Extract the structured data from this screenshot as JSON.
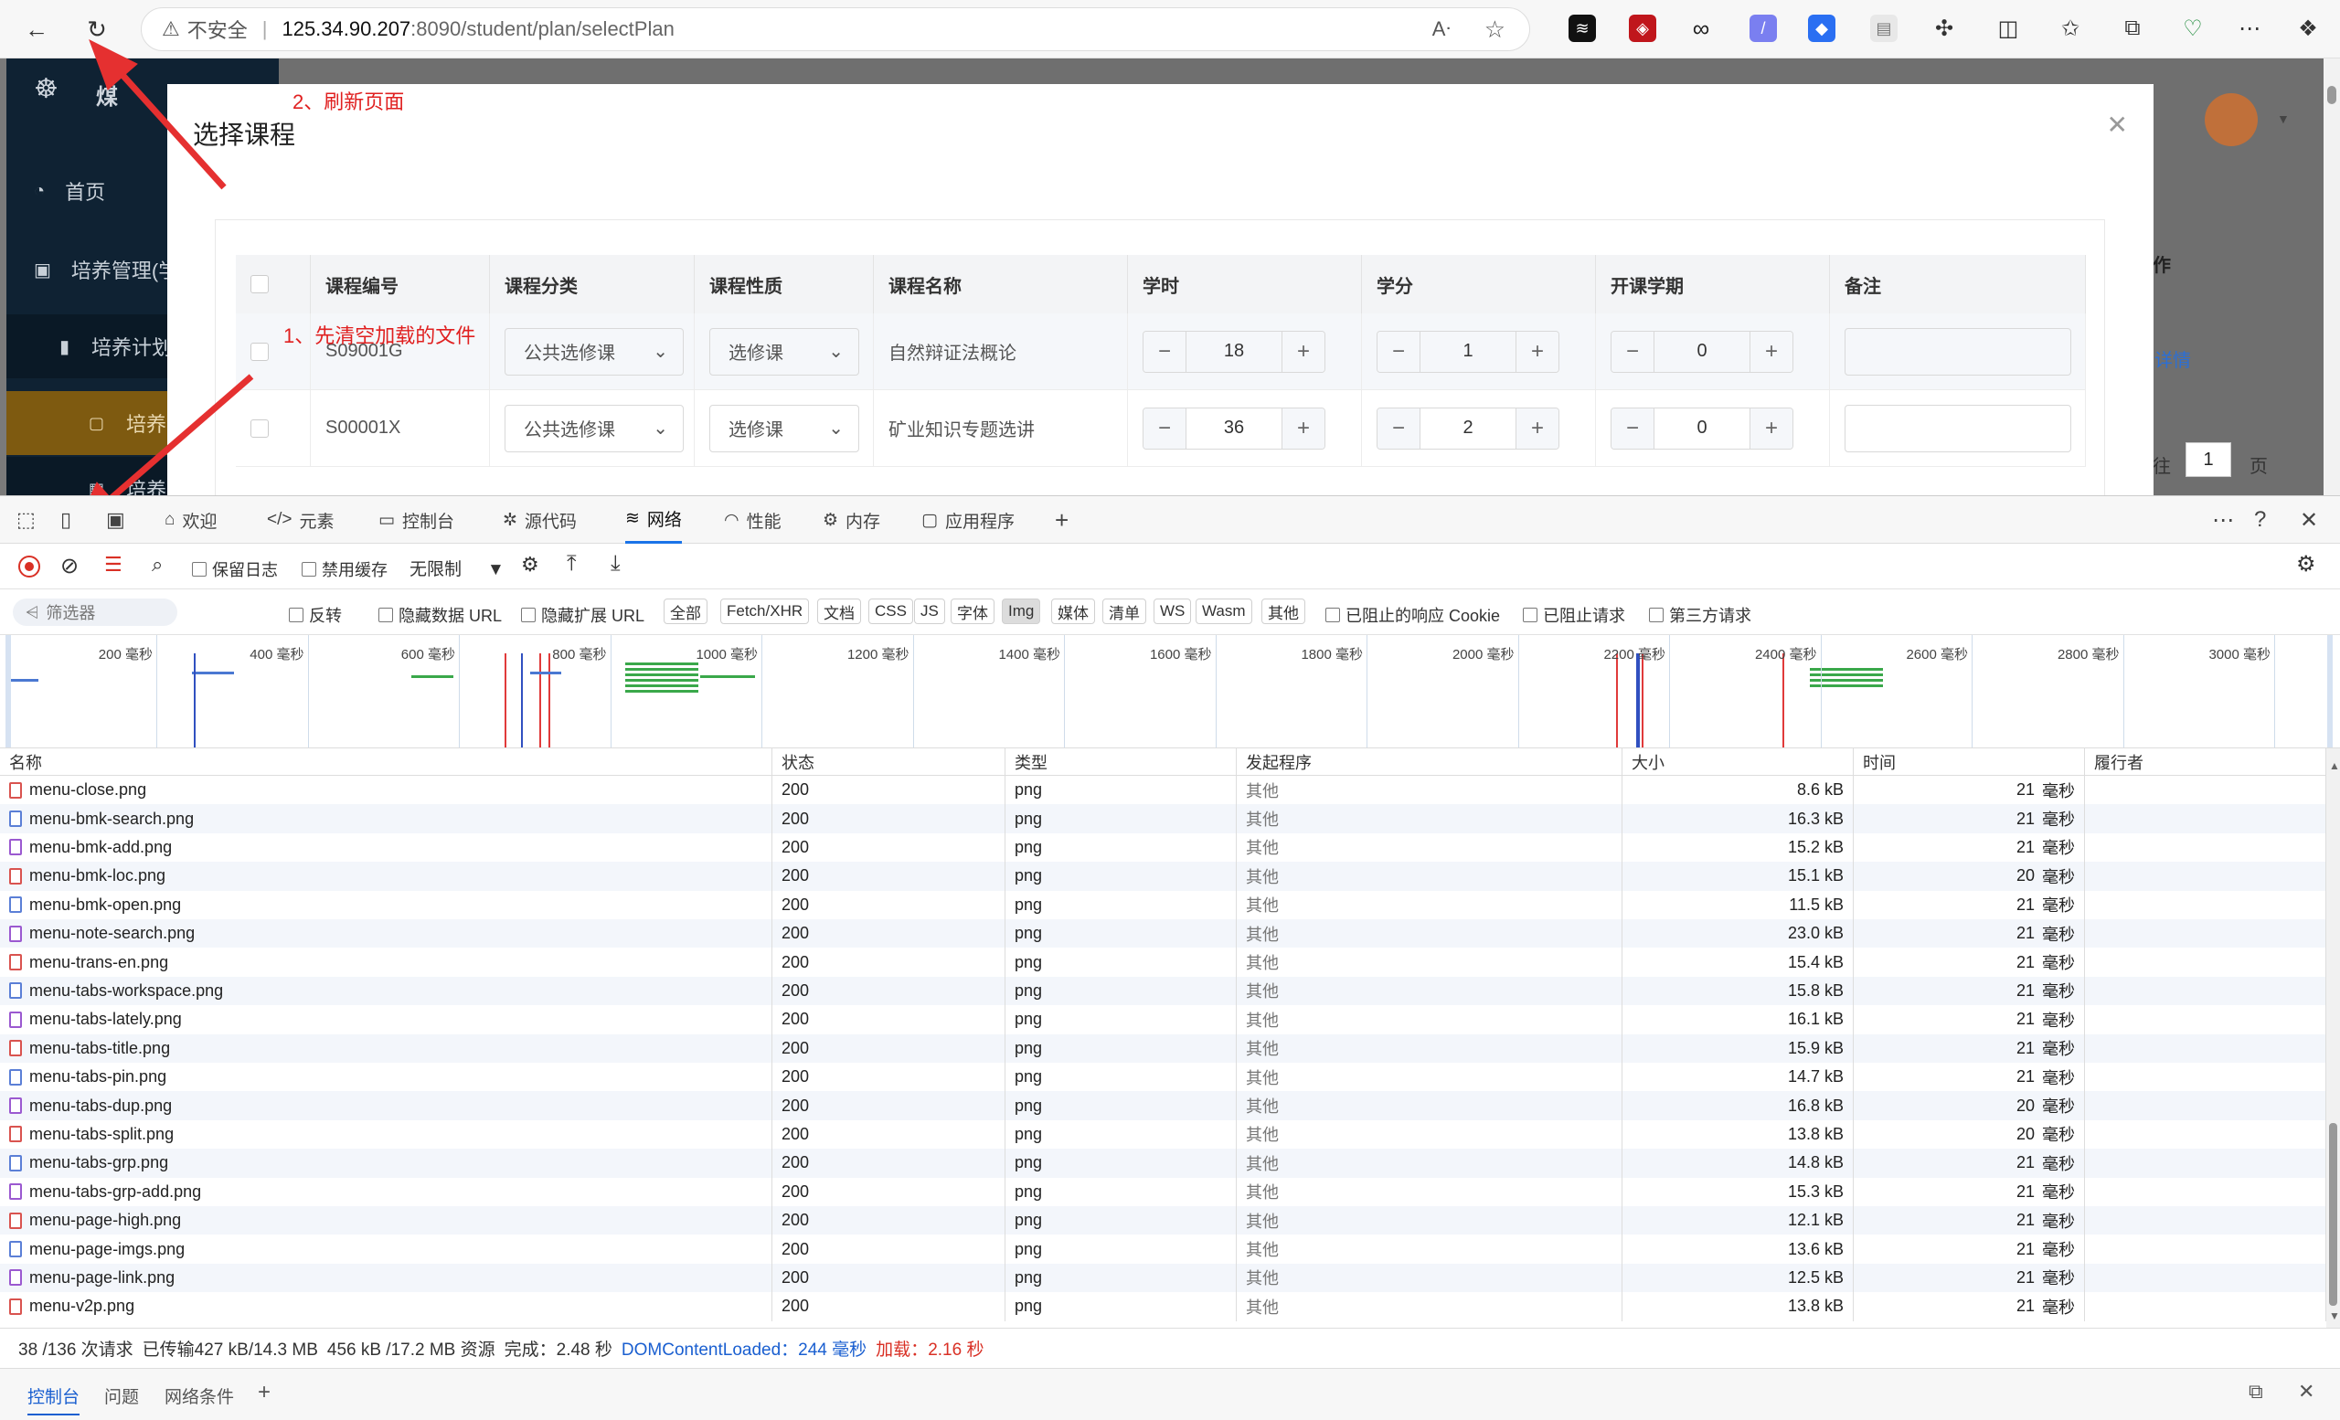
{
  "browser": {
    "insecure_label": "不安全",
    "url_host": "125.34.90.207",
    "url_path": ":8090/student/plan/selectPlan"
  },
  "sidebar": {
    "brand": "煤",
    "items": [
      {
        "label": "首页"
      },
      {
        "label": "培养管理(学"
      },
      {
        "label": "培养计划"
      },
      {
        "label": "培养"
      },
      {
        "label": "培养"
      }
    ]
  },
  "main_bg": {
    "op_header": "作",
    "detail_link": "详情",
    "page_number": "1",
    "page_suffix": "页",
    "page_prefix": "往"
  },
  "modal": {
    "title": "选择课程",
    "columns": [
      "课程编号",
      "课程分类",
      "课程性质",
      "课程名称",
      "学时",
      "学分",
      "开课学期",
      "备注"
    ],
    "rows": [
      {
        "code": "S09001G",
        "category": "公共选修课",
        "nature": "选修课",
        "name": "自然辩证法概论",
        "hours": "18",
        "credits": "1",
        "term": "0"
      },
      {
        "code": "S00001X",
        "category": "公共选修课",
        "nature": "选修课",
        "name": "矿业知识专题选讲",
        "hours": "36",
        "credits": "2",
        "term": "0"
      }
    ]
  },
  "annotations": {
    "step1": "1、先清空加载的文件",
    "step2": "2、刷新页面"
  },
  "devtools": {
    "tabs": [
      "欢迎",
      "元素",
      "控制台",
      "源代码",
      "网络",
      "性能",
      "内存",
      "应用程序"
    ],
    "active_tab": "网络",
    "toolbar": {
      "preserve_log": "保留日志",
      "disable_cache": "禁用缓存",
      "throttle": "无限制"
    },
    "filter": {
      "placeholder": "筛选器",
      "invert": "反转",
      "hide_data_urls": "隐藏数据 URL",
      "hide_ext_urls": "隐藏扩展 URL",
      "types": [
        "全部",
        "Fetch/XHR",
        "文档",
        "CSS",
        "JS",
        "字体",
        "Img",
        "媒体",
        "清单",
        "WS",
        "Wasm",
        "其他"
      ],
      "active_type": "Img",
      "blocked_cookies": "已阻止的响应 Cookie",
      "blocked_requests": "已阻止请求",
      "third_party": "第三方请求"
    },
    "timeline_ticks": [
      "200 毫秒",
      "400 毫秒",
      "600 毫秒",
      "800 毫秒",
      "1000 毫秒",
      "1200 毫秒",
      "1400 毫秒",
      "1600 毫秒",
      "1800 毫秒",
      "2000 毫秒",
      "2200 毫秒",
      "2400 毫秒",
      "2600 毫秒",
      "2800 毫秒",
      "3000 毫秒"
    ],
    "columns": [
      "名称",
      "状态",
      "类型",
      "发起程序",
      "大小",
      "时间",
      "履行者"
    ],
    "requests": [
      {
        "name": "menu-close.png",
        "status": "200",
        "type": "png",
        "initiator": "其他",
        "size": "8.6 kB",
        "time": "21",
        "unit": "毫秒"
      },
      {
        "name": "menu-bmk-search.png",
        "status": "200",
        "type": "png",
        "initiator": "其他",
        "size": "16.3 kB",
        "time": "21",
        "unit": "毫秒"
      },
      {
        "name": "menu-bmk-add.png",
        "status": "200",
        "type": "png",
        "initiator": "其他",
        "size": "15.2 kB",
        "time": "21",
        "unit": "毫秒"
      },
      {
        "name": "menu-bmk-loc.png",
        "status": "200",
        "type": "png",
        "initiator": "其他",
        "size": "15.1 kB",
        "time": "20",
        "unit": "毫秒"
      },
      {
        "name": "menu-bmk-open.png",
        "status": "200",
        "type": "png",
        "initiator": "其他",
        "size": "11.5 kB",
        "time": "21",
        "unit": "毫秒"
      },
      {
        "name": "menu-note-search.png",
        "status": "200",
        "type": "png",
        "initiator": "其他",
        "size": "23.0 kB",
        "time": "21",
        "unit": "毫秒"
      },
      {
        "name": "menu-trans-en.png",
        "status": "200",
        "type": "png",
        "initiator": "其他",
        "size": "15.4 kB",
        "time": "21",
        "unit": "毫秒"
      },
      {
        "name": "menu-tabs-workspace.png",
        "status": "200",
        "type": "png",
        "initiator": "其他",
        "size": "15.8 kB",
        "time": "21",
        "unit": "毫秒"
      },
      {
        "name": "menu-tabs-lately.png",
        "status": "200",
        "type": "png",
        "initiator": "其他",
        "size": "16.1 kB",
        "time": "21",
        "unit": "毫秒"
      },
      {
        "name": "menu-tabs-title.png",
        "status": "200",
        "type": "png",
        "initiator": "其他",
        "size": "15.9 kB",
        "time": "21",
        "unit": "毫秒"
      },
      {
        "name": "menu-tabs-pin.png",
        "status": "200",
        "type": "png",
        "initiator": "其他",
        "size": "14.7 kB",
        "time": "21",
        "unit": "毫秒"
      },
      {
        "name": "menu-tabs-dup.png",
        "status": "200",
        "type": "png",
        "initiator": "其他",
        "size": "16.8 kB",
        "time": "20",
        "unit": "毫秒"
      },
      {
        "name": "menu-tabs-split.png",
        "status": "200",
        "type": "png",
        "initiator": "其他",
        "size": "13.8 kB",
        "time": "20",
        "unit": "毫秒"
      },
      {
        "name": "menu-tabs-grp.png",
        "status": "200",
        "type": "png",
        "initiator": "其他",
        "size": "14.8 kB",
        "time": "21",
        "unit": "毫秒"
      },
      {
        "name": "menu-tabs-grp-add.png",
        "status": "200",
        "type": "png",
        "initiator": "其他",
        "size": "15.3 kB",
        "time": "21",
        "unit": "毫秒"
      },
      {
        "name": "menu-page-high.png",
        "status": "200",
        "type": "png",
        "initiator": "其他",
        "size": "12.1 kB",
        "time": "21",
        "unit": "毫秒"
      },
      {
        "name": "menu-page-imgs.png",
        "status": "200",
        "type": "png",
        "initiator": "其他",
        "size": "13.6 kB",
        "time": "21",
        "unit": "毫秒"
      },
      {
        "name": "menu-page-link.png",
        "status": "200",
        "type": "png",
        "initiator": "其他",
        "size": "12.5 kB",
        "time": "21",
        "unit": "毫秒"
      },
      {
        "name": "menu-v2p.png",
        "status": "200",
        "type": "png",
        "initiator": "其他",
        "size": "13.8 kB",
        "time": "21",
        "unit": "毫秒"
      }
    ],
    "summary": {
      "requests": "38 /136 次请求",
      "transferred": "已传输427 kB/14.3 MB",
      "resources": "456 kB /17.2 MB 资源",
      "finish": "完成：2.48 秒",
      "dcl_label": "DOMContentLoaded：",
      "dcl_value": "244",
      "dcl_unit": "毫秒",
      "load_label": "加载：",
      "load_value": "2.16 秒"
    },
    "drawer_tabs": [
      "控制台",
      "问题",
      "网络条件"
    ]
  }
}
